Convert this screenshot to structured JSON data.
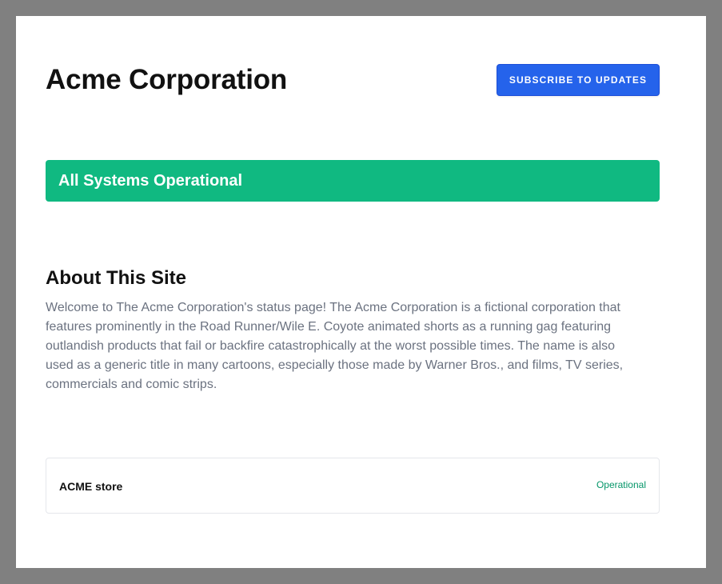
{
  "header": {
    "company_name": "Acme Corporation",
    "subscribe_label": "Subscribe to Updates"
  },
  "status_banner": {
    "text": "All Systems Operational",
    "color": "#10b981"
  },
  "about": {
    "title": "About This Site",
    "description": "Welcome to The Acme Corporation's status page! The Acme Corporation is a fictional corporation that features prominently in the Road Runner/Wile E. Coyote animated shorts as a running gag featuring outlandish products that fail or backfire catastrophically at the worst possible times. The name is also used as a generic title in many cartoons, especially those made by Warner Bros., and films, TV series, commercials and comic strips."
  },
  "components": [
    {
      "name": "ACME store",
      "status": "Operational",
      "status_color": "#059669"
    }
  ],
  "colors": {
    "accent": "#2563eb",
    "operational": "#10b981",
    "backdrop": "#808080"
  }
}
